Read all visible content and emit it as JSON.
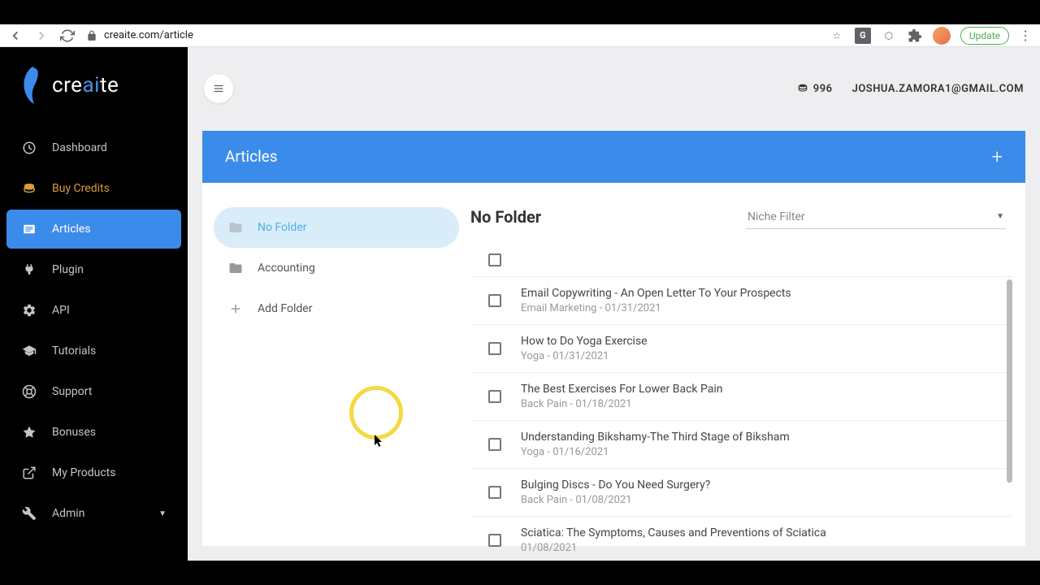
{
  "browser": {
    "url": "creaite.com/article",
    "update_label": "Update"
  },
  "logo": {
    "pre": "cre",
    "mid": "ai",
    "post": "te"
  },
  "sidebar": {
    "items": [
      {
        "label": "Dashboard"
      },
      {
        "label": "Buy Credits"
      },
      {
        "label": "Articles"
      },
      {
        "label": "Plugin"
      },
      {
        "label": "API"
      },
      {
        "label": "Tutorials"
      },
      {
        "label": "Support"
      },
      {
        "label": "Bonuses"
      },
      {
        "label": "My Products"
      },
      {
        "label": "Admin"
      }
    ]
  },
  "topbar": {
    "credits": "996",
    "user": "JOSHUA.ZAMORA1@GMAIL.COM"
  },
  "page": {
    "title": "Articles"
  },
  "folders": {
    "items": [
      {
        "label": "No Folder"
      },
      {
        "label": "Accounting"
      },
      {
        "label": "Add Folder"
      }
    ]
  },
  "articles": {
    "title": "No Folder",
    "filter_label": "Niche Filter",
    "list": [
      {
        "title": "Email Copywriting - An Open Letter To Your Prospects",
        "meta": "Email Marketing - 01/31/2021"
      },
      {
        "title": "How to Do Yoga Exercise",
        "meta": "Yoga - 01/31/2021"
      },
      {
        "title": "The Best Exercises For Lower Back Pain",
        "meta": "Back Pain - 01/18/2021"
      },
      {
        "title": "Understanding Bikshamy-The Third Stage of Biksham",
        "meta": "Yoga - 01/16/2021"
      },
      {
        "title": "Bulging Discs - Do You Need Surgery?",
        "meta": "Back Pain - 01/08/2021"
      },
      {
        "title": "Sciatica: The Symptoms, Causes and Preventions of Sciatica",
        "meta": "01/08/2021"
      }
    ]
  }
}
